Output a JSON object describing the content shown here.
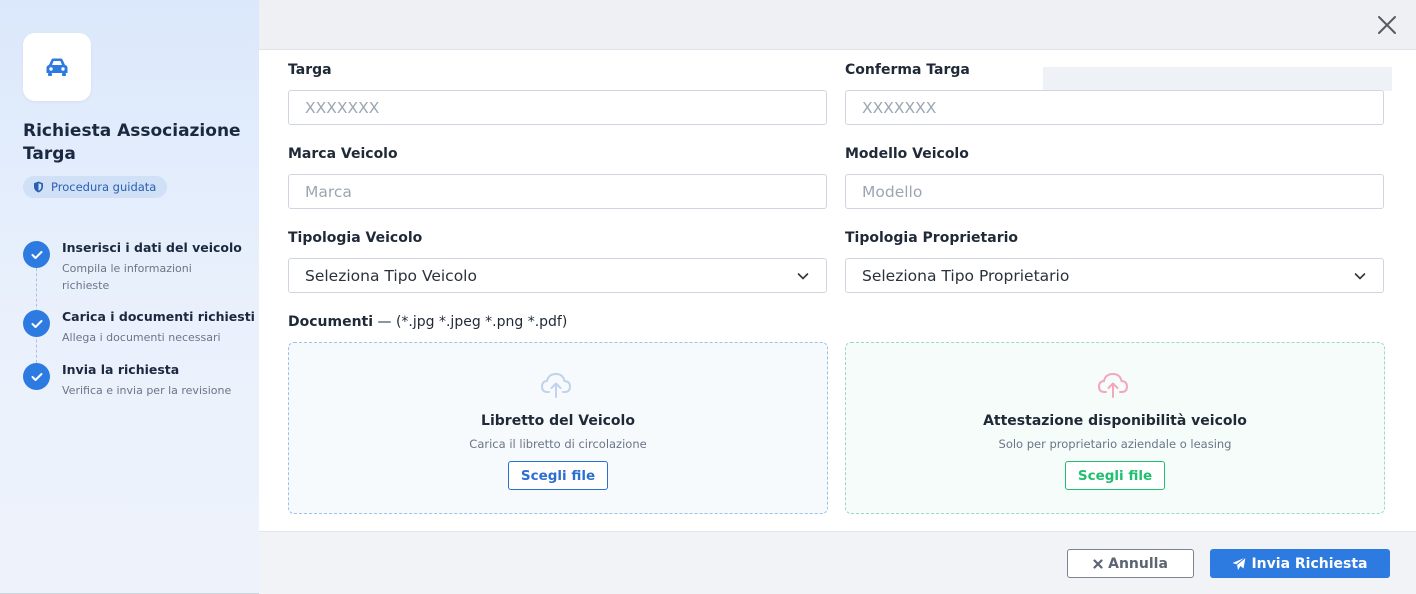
{
  "sidebar": {
    "logo_icon": "car-icon",
    "title": "Richiesta Associazione Targa",
    "badge": "Procedura guidata",
    "steps": [
      {
        "title": "Inserisci i dati del veicolo",
        "desc": "Compila le informazioni richieste"
      },
      {
        "title": "Carica i documenti richiesti",
        "desc": "Allega i documenti necessari"
      },
      {
        "title": "Invia la richiesta",
        "desc": "Verifica e invia per la revisione"
      }
    ]
  },
  "form": {
    "targa": {
      "label": "Targa",
      "placeholder": "XXXXXXX"
    },
    "conferma_targa": {
      "label": "Conferma Targa",
      "placeholder": "XXXXXXX"
    },
    "marca": {
      "label": "Marca Veicolo",
      "placeholder": "Marca"
    },
    "modello": {
      "label": "Modello Veicolo",
      "placeholder": "Modello"
    },
    "tipologia_veicolo": {
      "label": "Tipologia Veicolo",
      "value": "Seleziona Tipo Veicolo"
    },
    "tipologia_proprietario": {
      "label": "Tipologia Proprietario",
      "value": "Seleziona Tipo Proprietario"
    }
  },
  "documents": {
    "label": "Documenti",
    "formats": " — (*.jpg *.jpeg *.png *.pdf)",
    "libretto": {
      "title": "Libretto del Veicolo",
      "subtitle": "Carica il libretto di circolazione",
      "button": "Scegli file"
    },
    "attestazione": {
      "title": "Attestazione disponibilità veicolo",
      "subtitle": "Solo per proprietario aziendale o leasing",
      "button": "Scegli file"
    }
  },
  "footer": {
    "cancel": "Annulla",
    "submit": "Invia Richiesta"
  },
  "colors": {
    "primary": "#2d7be0",
    "success": "#1fbf6f",
    "accent_pink": "#f4a6bd"
  }
}
